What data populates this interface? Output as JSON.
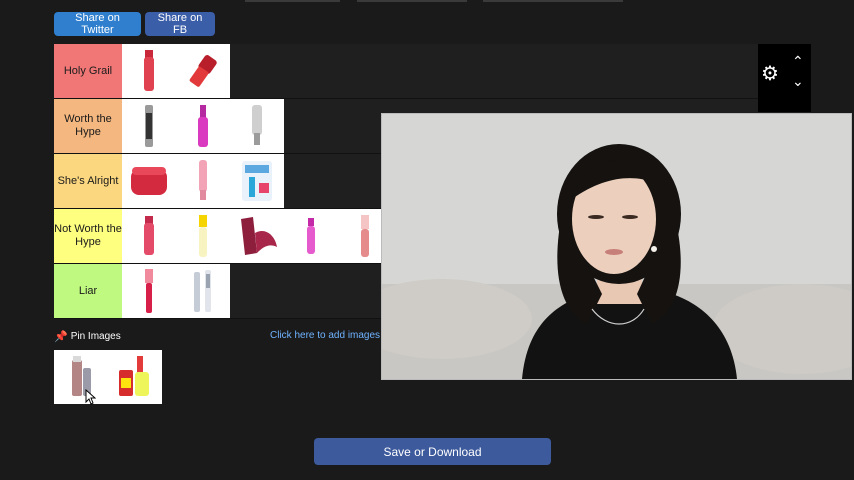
{
  "share": {
    "twitter_label": "Share on Twitter",
    "fb_label": "Share on FB"
  },
  "tiers": [
    {
      "label": "Holy Grail",
      "color": "#f07776"
    },
    {
      "label": "Worth the Hype",
      "color": "#f4b77f"
    },
    {
      "label": "She's Alright",
      "color": "#fbd77f"
    },
    {
      "label": "Not Worth the Hype",
      "color": "#fefe7f"
    },
    {
      "label": "Liar",
      "color": "#bff97f"
    }
  ],
  "pin": {
    "label": "Pin Images",
    "icon": "pin-icon"
  },
  "add_images_label": "Click here to add images",
  "save_label": "Save or Download",
  "colors": {
    "save_button": "#3c5a9c",
    "twitter": "#2f7fce",
    "fb": "#3b5ea8"
  }
}
